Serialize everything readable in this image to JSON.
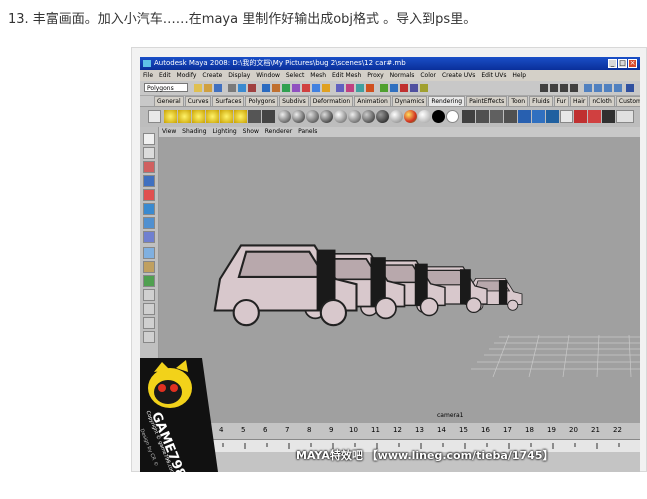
{
  "caption": "13. 丰富画面。加入小汽车……在maya 里制作好输出成obj格式 。导入到ps里。",
  "maya": {
    "title": "Autodesk Maya 2008: D:\\我的文档\\My Pictures\\bug 2\\scenes\\12 car#.mb",
    "window_buttons": [
      "_",
      "□",
      "×"
    ],
    "menus": [
      "File",
      "Edit",
      "Modify",
      "Create",
      "Display",
      "Window",
      "Select",
      "Mesh",
      "Edit Mesh",
      "Proxy",
      "Normals",
      "Color",
      "Create UVs",
      "Edit UVs",
      "Help"
    ],
    "mode": "Polygons",
    "shelf_tabs": [
      "General",
      "Curves",
      "Surfaces",
      "Polygons",
      "Subdivs",
      "Deformation",
      "Animation",
      "Dynamics",
      "Rendering",
      "PaintEffects",
      "Toon",
      "Fluids",
      "Fur",
      "Hair",
      "nCloth",
      "Custom"
    ],
    "active_shelf": "Rendering",
    "panel_menus": [
      "View",
      "Shading",
      "Lighting",
      "Show",
      "Renderer",
      "Panels"
    ],
    "camera_label": "camera1",
    "timeline_ticks": [
      "3",
      "4",
      "5",
      "6",
      "7",
      "8",
      "9",
      "10",
      "11",
      "12",
      "13",
      "14",
      "15",
      "16",
      "17",
      "18",
      "19",
      "20",
      "21",
      "22"
    ]
  },
  "logo": {
    "text": "GAME798",
    "subtext": "Copyright © game798.com",
    "bottom_text": "Design by CR ©"
  },
  "watermark": "MAYA特效吧 【www.lineg.com/tieba/1745】",
  "colors": {
    "titlebar": "#1a4fc7",
    "viewport": "#a0a0a0",
    "car_body": "#d8c8cc",
    "car_dark": "#1a1a1a"
  }
}
